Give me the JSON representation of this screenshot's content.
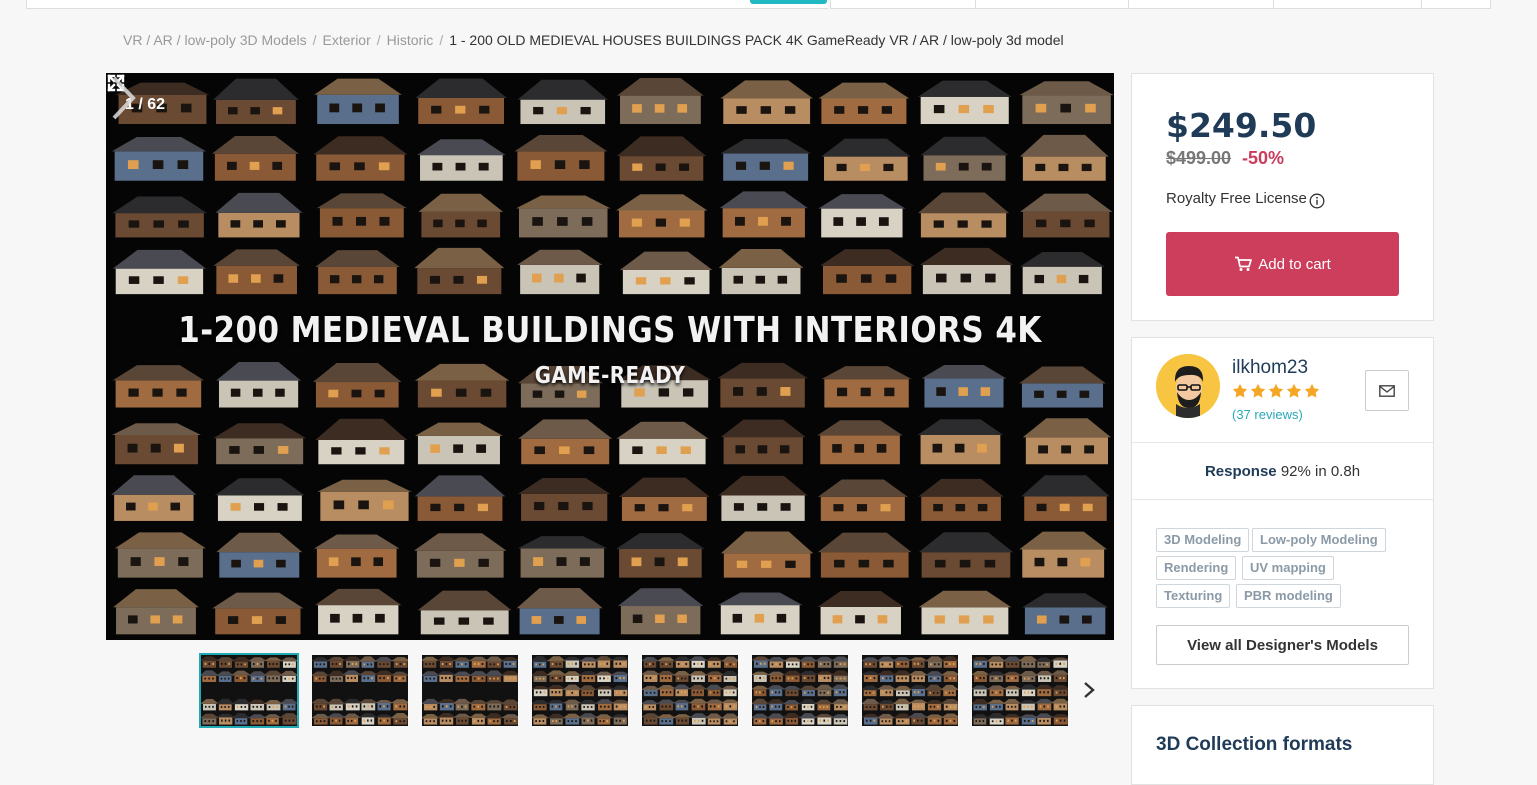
{
  "breadcrumb": {
    "items": [
      "VR / AR / low-poly 3D Models",
      "Exterior",
      "Historic"
    ],
    "separator": "/",
    "current": "1 - 200 OLD MEDIEVAL HOUSES BUILDINGS PACK 4K GameReady VR / AR / low-poly 3d model"
  },
  "gallery": {
    "counter": "1 / 62",
    "headline_main": "1-200 MEDIEVAL BUILDINGS WITH INTERIORS 4K",
    "headline_small": "GAME-READY",
    "thumbnail_count": 8,
    "active_thumbnail": 0
  },
  "purchase": {
    "price": "$249.50",
    "old_price": "$499.00",
    "discount": "-50%",
    "license": "Royalty Free License",
    "add_to_cart": "Add to cart",
    "accent_color": "#cd3d5c"
  },
  "designer": {
    "name": "ilkhom23",
    "rating": 5,
    "reviews": "(37 reviews)",
    "response_label": "Response",
    "response_value": "92% in 0.8h",
    "skills": [
      "3D Modeling",
      "Low-poly Modeling",
      "Rendering",
      "UV mapping",
      "Texturing",
      "PBR modeling"
    ],
    "view_all": "View all Designer's Models"
  },
  "formats": {
    "title": "3D Collection formats"
  },
  "colors": {
    "brand_teal": "#21b8c4",
    "navy": "#1f3b57",
    "star": "#f5a623"
  }
}
